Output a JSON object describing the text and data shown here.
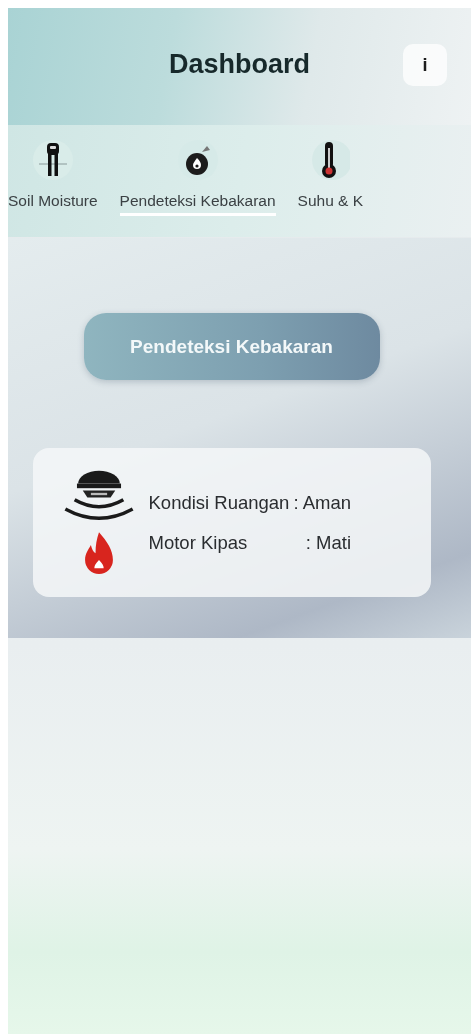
{
  "header": {
    "title": "Dashboard",
    "info_button": "i"
  },
  "tabs": [
    {
      "kind": "soil",
      "label": "Soil Moisture",
      "selected": false
    },
    {
      "kind": "fire",
      "label": "Pendeteksi Kebakaran",
      "selected": true
    },
    {
      "kind": "thermometer",
      "label": "Suhu & K",
      "selected": false
    }
  ],
  "section_button": "Pendeteksi Kebakaran",
  "status_card": {
    "rows": [
      {
        "label": "Kondisi Ruangan",
        "value": ": Aman"
      },
      {
        "label": "Motor Kipas",
        "value": ": Mati"
      }
    ]
  }
}
